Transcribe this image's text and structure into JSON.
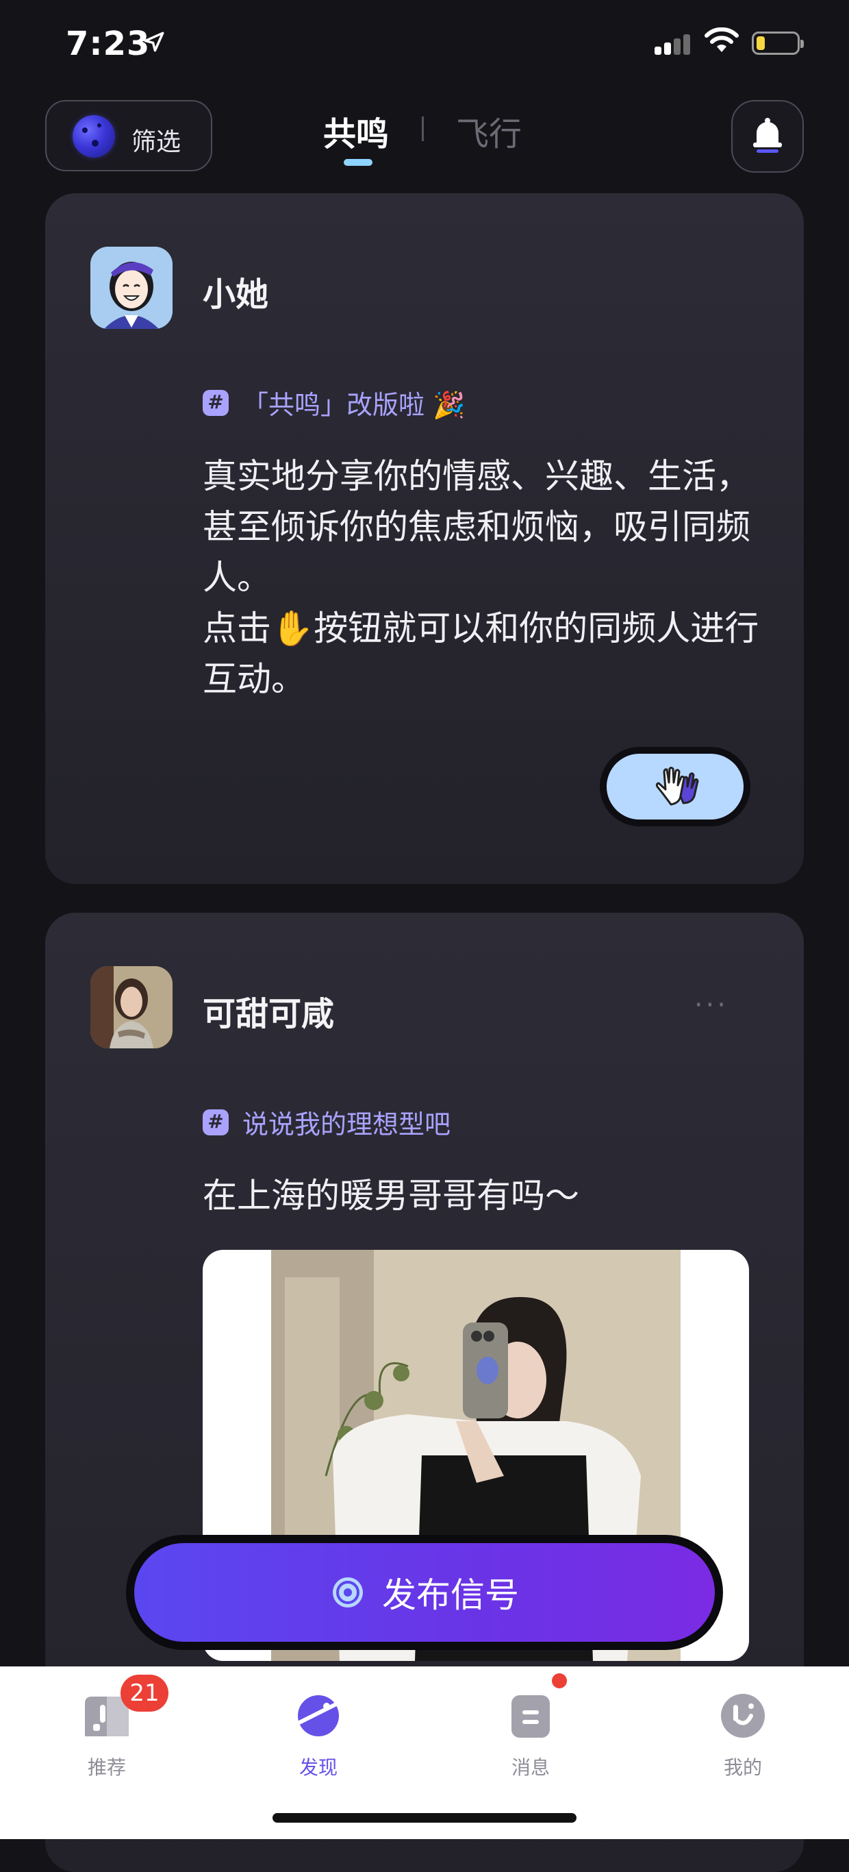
{
  "status_bar": {
    "time": "7:23"
  },
  "header": {
    "filter_label": "筛选",
    "tabs": [
      {
        "label": "共鸣",
        "active": true
      },
      {
        "label": "飞行",
        "active": false
      }
    ]
  },
  "posts": [
    {
      "username": "小她",
      "topic": "「共鸣」改版啦 🎉",
      "text": "真实地分享你的情感、兴趣、生活，甚至倾诉你的焦虑和烦恼，吸引同频人。\n点击✋按钮就可以和你的同频人进行互动。"
    },
    {
      "username": "可甜可咸",
      "topic": "说说我的理想型吧",
      "text": "在上海的暖男哥哥有吗～",
      "more": "···"
    }
  ],
  "publish_button": {
    "label": "发布信号"
  },
  "bottom_nav": [
    {
      "label": "推荐",
      "badge": "21"
    },
    {
      "label": "发现",
      "active": true
    },
    {
      "label": "消息",
      "has_dot": true
    },
    {
      "label": "我的"
    }
  ],
  "colors": {
    "accent": "#6651e8",
    "topic": "#a9a3ff",
    "badge": "#ec3f36",
    "clap_button": "#b7d9ff"
  }
}
